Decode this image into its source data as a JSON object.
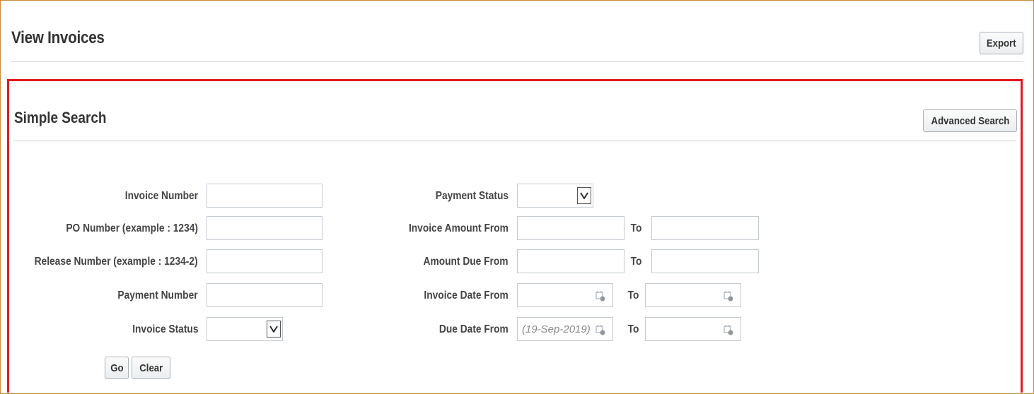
{
  "header": {
    "title": "View Invoices",
    "export_label": "Export"
  },
  "simple_search": {
    "title": "Simple Search",
    "advanced_label": "Advanced Search",
    "fields": {
      "invoice_number": {
        "label": "Invoice Number",
        "value": ""
      },
      "po_number": {
        "label": "PO Number (example : 1234)",
        "value": ""
      },
      "release_number": {
        "label": "Release Number (example : 1234-2)",
        "value": ""
      },
      "payment_number": {
        "label": "Payment Number",
        "value": ""
      },
      "invoice_status": {
        "label": "Invoice Status",
        "selected": ""
      },
      "payment_status": {
        "label": "Payment Status",
        "selected": ""
      },
      "invoice_amount": {
        "label": "Invoice Amount From",
        "to_label": "To",
        "from": "",
        "to": ""
      },
      "amount_due": {
        "label": "Amount Due From",
        "to_label": "To",
        "from": "",
        "to": ""
      },
      "invoice_date": {
        "label": "Invoice Date From",
        "to_label": "To",
        "from": "",
        "to": ""
      },
      "due_date": {
        "label": "Due Date From",
        "to_label": "To",
        "from": "",
        "from_placeholder": "(19-Sep-2019)",
        "to": ""
      }
    },
    "go_label": "Go",
    "clear_label": "Clear"
  },
  "colors": {
    "outer_border": "#c98a3a",
    "highlight_border": "#e3191d",
    "rule": "#cfd6dc"
  },
  "icons": {
    "calendar": "calendar-icon",
    "dropdown": "chevron-down-icon"
  }
}
